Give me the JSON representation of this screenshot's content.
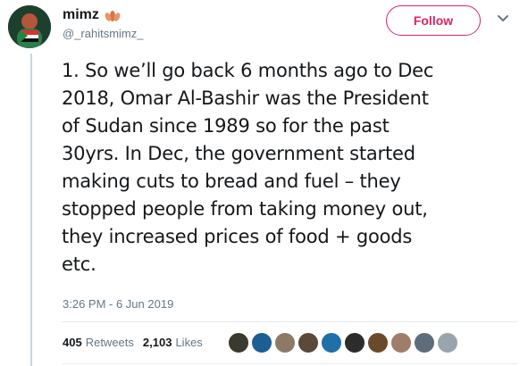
{
  "user": {
    "display_name": "mimz",
    "handle": "@_rahitsmimz_",
    "avatar_icon": "profile-avatar-icon",
    "emoji_icon": "lotus-emoji-icon"
  },
  "follow_label": "Follow",
  "tweet_lines": [
    "1. So we’ll go back 6 months ago to Dec",
    "2018, Omar Al-Bashir was the President",
    "of Sudan since 1989 so for the past",
    "30yrs. In Dec, the government started",
    "making cuts to bread and fuel – they",
    "stopped people from taking money out,",
    "they increased prices of food + goods",
    "etc."
  ],
  "timestamp": "3:26 PM - 6 Jun 2019",
  "stats": {
    "retweets_count": "405",
    "retweets_label": "Retweets",
    "likes_count": "2,103",
    "likes_label": "Likes"
  },
  "likers": [
    {
      "color": "#3a3a2e"
    },
    {
      "color": "#1b5e94"
    },
    {
      "color": "#8c7a66"
    },
    {
      "color": "#5b4a3a"
    },
    {
      "color": "#1f6fa8"
    },
    {
      "color": "#2c2c2c"
    },
    {
      "color": "#6b4a2b"
    },
    {
      "color": "#a07c6a"
    },
    {
      "color": "#5d6d7a"
    },
    {
      "color": "#9aa4ac"
    }
  ],
  "colors": {
    "follow_accent": "#e0245e",
    "muted": "#657786",
    "text": "#14171a"
  }
}
